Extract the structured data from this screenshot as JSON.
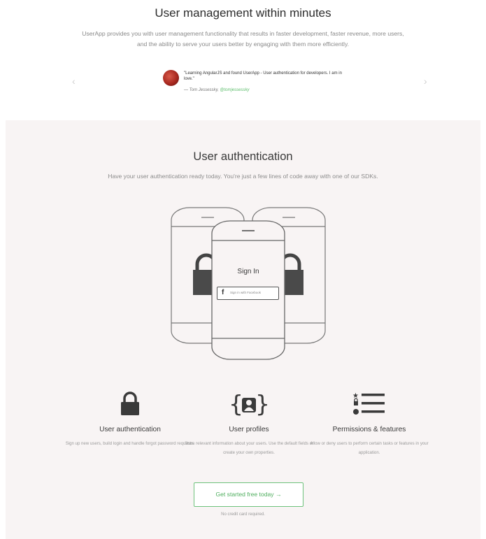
{
  "header": {
    "title": "User management within minutes",
    "subtitle": "UserApp provides you with user management functionality that results in faster development, faster revenue, more users, and the ability to serve your users better by engaging with them more efficiently.",
    "prev_arrow": "‹",
    "next_arrow": "›"
  },
  "testimonial": {
    "quote": "\"Learning AngularJS and found UserApp - User authentication for developers. I am in love.\"",
    "author_prefix": "— Tom Jessessky,",
    "handle": "@tomjessessky"
  },
  "auth_section": {
    "title": "User authentication",
    "subtitle": "Have your user authentication ready today. You're just a few lines of code away with one of our SDKs.",
    "signin_title": "Sign In",
    "facebook_icon": "f",
    "facebook_button": "Sign in with Facebook"
  },
  "features": [
    {
      "icon": "lock-icon",
      "title": "User authentication",
      "description": "Sign up new users, build login and handle forgot password requests."
    },
    {
      "icon": "user-profile-icon",
      "title": "User profiles",
      "description": "Store relevant information about your users. Use the default fields or create your own properties."
    },
    {
      "icon": "permissions-list-icon",
      "title": "Permissions & features",
      "description": "Allow or deny users to perform certain tasks or features in your application."
    }
  ],
  "cta": {
    "label": "Get started free today →",
    "note": "No credit card required."
  },
  "colors": {
    "accent_green": "#5bbd6a",
    "panel_bg": "#f8f4f4",
    "icon_dark": "#3a3a3a"
  }
}
